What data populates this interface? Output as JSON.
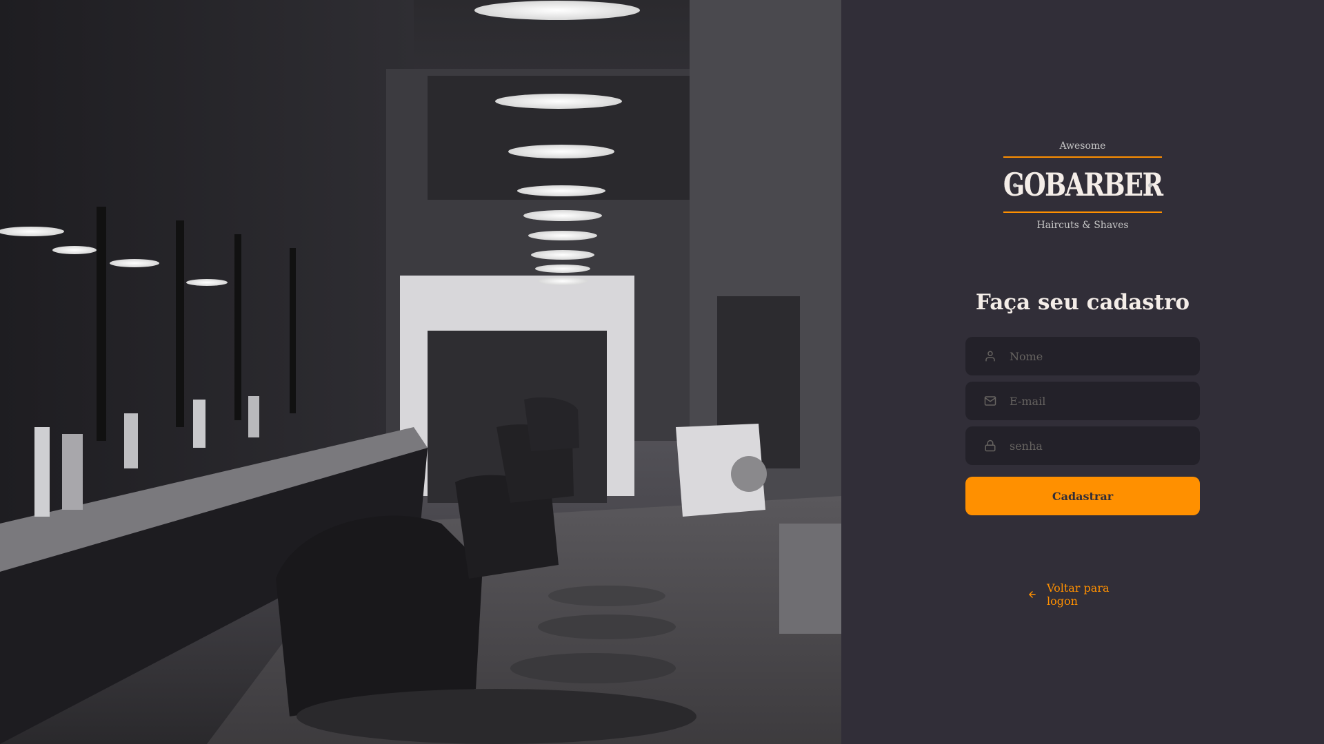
{
  "logo": {
    "top_text": "Awesome",
    "brand": "GOBARBER",
    "bottom_text": "Haircuts & Shaves"
  },
  "form": {
    "title": "Faça seu cadastro",
    "name_placeholder": "Nome",
    "email_placeholder": "E-mail",
    "password_placeholder": "senha",
    "submit_label": "Cadastrar"
  },
  "back_link": {
    "label": "Voltar para logon",
    "icon": "arrow-left-icon"
  },
  "colors": {
    "background": "#312e38",
    "input_bg": "#232129",
    "accent": "#ff9000",
    "text": "#f4ede8",
    "placeholder": "#666360"
  },
  "icons": {
    "name": "user-icon",
    "email": "mail-icon",
    "password": "lock-icon"
  }
}
